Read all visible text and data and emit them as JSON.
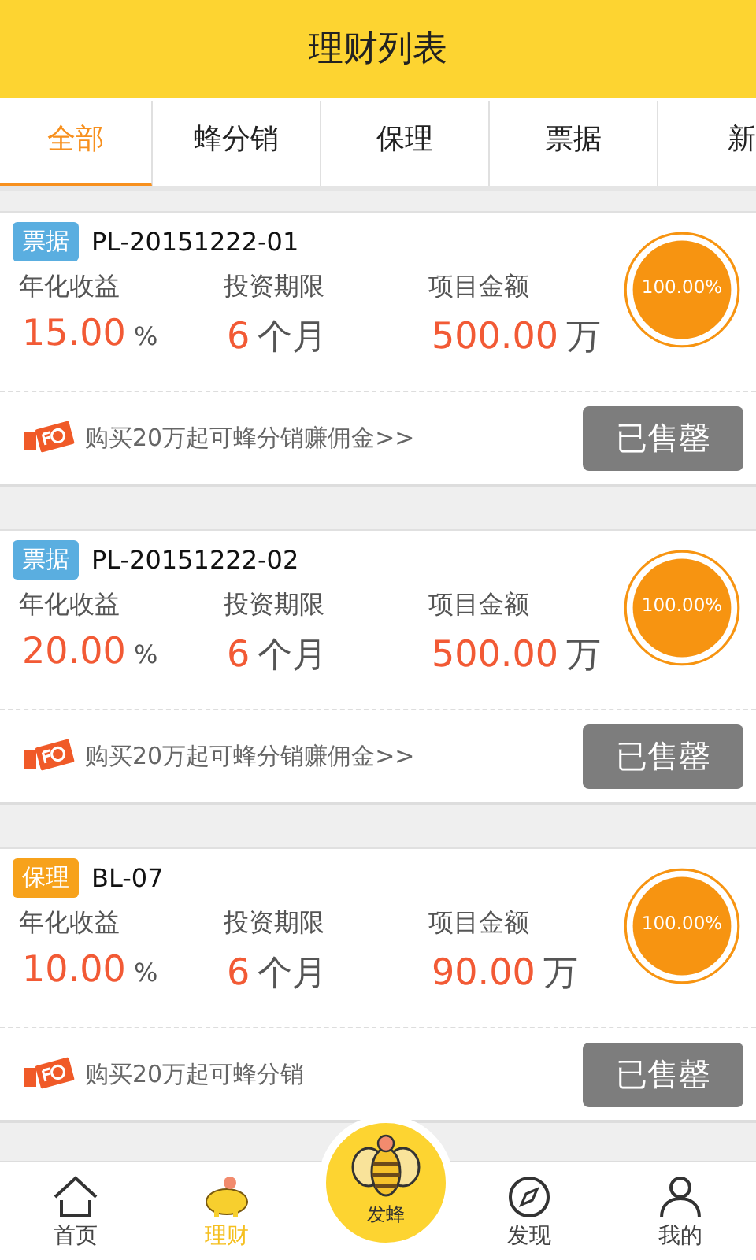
{
  "header": {
    "title": "理财列表"
  },
  "tabs": [
    {
      "label": "全部",
      "selected": true
    },
    {
      "label": "蜂分销",
      "selected": false
    },
    {
      "label": "保理",
      "selected": false
    },
    {
      "label": "票据",
      "selected": false
    },
    {
      "label": "新",
      "selected": false
    }
  ],
  "products": [
    {
      "tag": "票据",
      "color": "#5aaee0",
      "code": "PL-20151222-01",
      "labels": [
        "年化收益",
        "投资期限",
        "项目金额"
      ],
      "rate": "15.00",
      "rate_unit": "%",
      "term": "6",
      "term_unit": "个月",
      "amount": "500.00",
      "amount_unit": "万",
      "progress": "100.00%",
      "level": 1,
      "promo": "购买20万起可蜂分销赚佣金>>",
      "button": "已售罄"
    },
    {
      "tag": "票据",
      "color": "#5aaee0",
      "code": "PL-20151222-02",
      "labels": [
        "年化收益",
        "投资期限",
        "项目金额"
      ],
      "rate": "20.00",
      "rate_unit": "%",
      "term": "6",
      "term_unit": "个月",
      "amount": "500.00",
      "amount_unit": "万",
      "progress": "100.00%",
      "level": 1,
      "promo": "购买20万起可蜂分销赚佣金>>",
      "button": "已售罄"
    },
    {
      "tag": "保理",
      "color": "#f7a21b",
      "code": "BL-07",
      "labels": [
        "年化收益",
        "投资期限",
        "项目金额"
      ],
      "rate": "10.00",
      "rate_unit": "%",
      "term": "6",
      "term_unit": "个月",
      "amount": "90.00",
      "amount_unit": "万",
      "progress": "100.00%",
      "level": 1,
      "promo": "购买20万起可蜂分销",
      "button": "已售罄"
    }
  ],
  "nav": [
    {
      "label": "首页",
      "kind": "home",
      "selected": false
    },
    {
      "label": "理财",
      "kind": "piggy",
      "selected": true
    },
    {
      "label": "发蜂",
      "kind": "bee",
      "selected": false
    },
    {
      "label": "发现",
      "kind": "compass",
      "selected": false
    },
    {
      "label": "我的",
      "kind": "person",
      "selected": false
    }
  ]
}
